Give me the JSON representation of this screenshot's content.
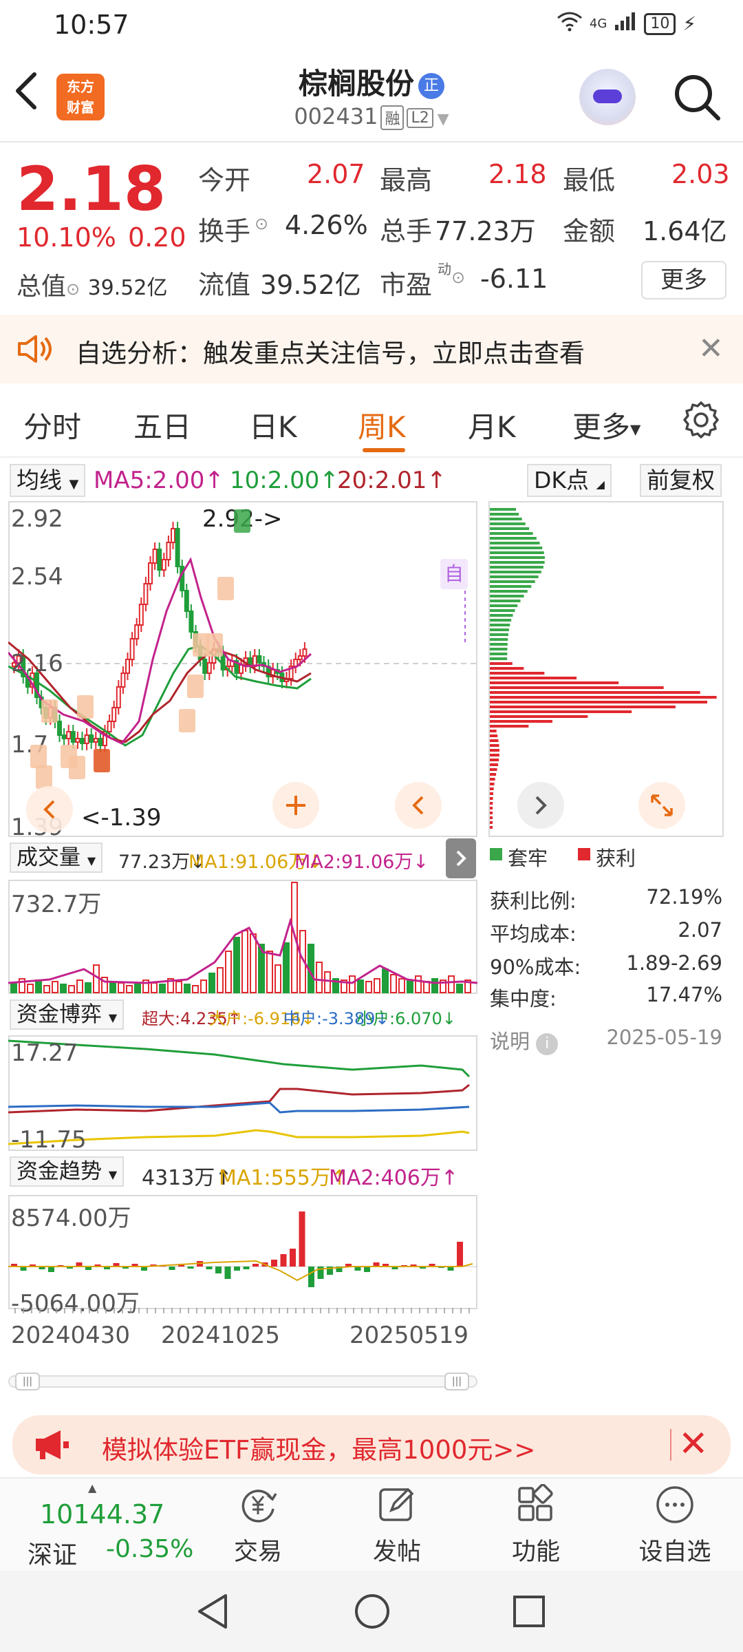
{
  "status": {
    "time": "10:57",
    "network": "4G",
    "battery": "10"
  },
  "header": {
    "logo_line1": "东方",
    "logo_line2": "财富",
    "name": "棕榈股份",
    "badge": "正",
    "code": "002431",
    "tag_margin": "融",
    "tag_level": "L2"
  },
  "quote": {
    "price": "2.18",
    "pct": "10.10%",
    "change": "0.20",
    "open_label": "今开",
    "open": "2.07",
    "high_label": "最高",
    "high": "2.18",
    "low_label": "最低",
    "low": "2.03",
    "turnover_label": "换手",
    "turnover": "4.26%",
    "volume_label": "总手",
    "volume": "77.23万",
    "amount_label": "金额",
    "amount": "1.64亿",
    "mktcap_label": "总值",
    "mktcap": "39.52亿",
    "float_label": "流值",
    "float": "39.52亿",
    "pe_label": "市盈",
    "pe_sup": "动",
    "pe": "-6.11",
    "more": "更多"
  },
  "alert": {
    "text": "自选分析：触发重点关注信号，立即点击查看"
  },
  "tabs": [
    "分时",
    "五日",
    "日K",
    "周K",
    "月K",
    "更多"
  ],
  "active_tab": "周K",
  "kline": {
    "indicator": "均线",
    "ma5": "MA5:2.00↑",
    "ma10": "10:2.00↑",
    "ma20": "20:2.01↑",
    "dk_btn": "DK点",
    "fq_btn": "前复权",
    "y_high": "2.92",
    "y_mid1": "2.54",
    "y_mid2": "2.16",
    "y_mid3": "1.7",
    "y_low": "1.39",
    "max_marker": "2.92->",
    "min_marker": "<-1.39",
    "self_tag": "自",
    "colors": {
      "up": "#e0282e",
      "down": "#1f9e3a",
      "ma5": "#c2228c",
      "ma10": "#1f9e3a",
      "ma20": "#b0242c"
    }
  },
  "chips": {
    "legend_trap": "套牢",
    "legend_profit": "获利",
    "profit_ratio_label": "获利比例:",
    "profit_ratio": "72.19%",
    "avg_cost_label": "平均成本:",
    "avg_cost": "2.07",
    "cost90_label": "90%成本:",
    "cost90": "1.89-2.69",
    "concentration_label": "集中度:",
    "concentration": "17.47%",
    "note": "说明",
    "date": "2025-05-19"
  },
  "volume": {
    "title": "成交量",
    "value": "77.23万↓",
    "ma1": "MA1:91.06万↓",
    "ma2": "MA2:91.06万↓",
    "y_high": "732.7万"
  },
  "capital_game": {
    "title": "资金博弈",
    "super": "超大:4.235↑",
    "large": "大户:-6.916↓",
    "mid": "中户:-3.389↓",
    "small": "小户:6.070↓",
    "y_high": "17.27",
    "y_low": "-11.75"
  },
  "capital_trend": {
    "title": "资金趋势",
    "value": "4313万↑",
    "ma1": "MA1:555万↑",
    "ma2": "MA2:406万↑",
    "y_high": "8574.00万",
    "y_low": "-5064.00万"
  },
  "x_dates": [
    "20240430",
    "20241025",
    "20250519"
  ],
  "promo": {
    "text": "模拟体验ETF赢现金，最高1000元>>"
  },
  "bottom_nav": {
    "index_value": "10144.37",
    "index_name": "深证",
    "index_change": "-0.35%",
    "items": [
      "交易",
      "发帖",
      "功能",
      "设自选"
    ]
  }
}
